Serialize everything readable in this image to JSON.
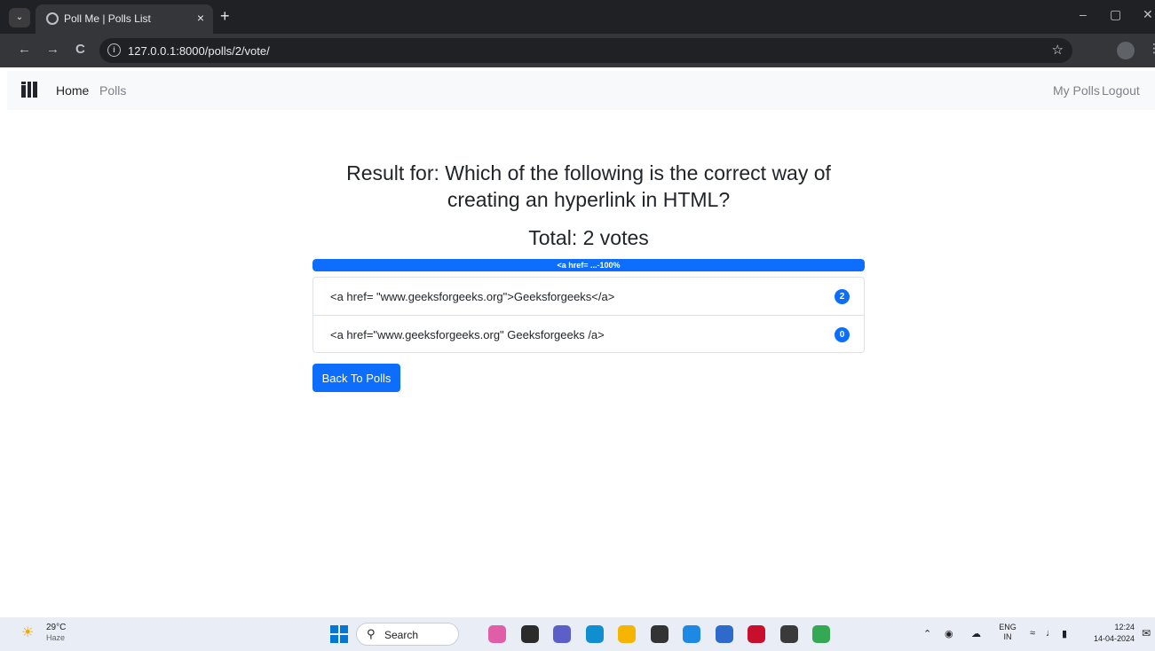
{
  "browser": {
    "tab_title": "Poll Me | Polls List",
    "url": "127.0.0.1:8000/polls/2/vote/",
    "new_tab": "+",
    "tab_close": "×",
    "minimize": "–",
    "restore": "▢",
    "close": "✕",
    "back": "←",
    "forward": "→",
    "reload": "C",
    "info": "i",
    "star": "☆",
    "kebab": "⋮",
    "tab_menu": "⌄"
  },
  "navbar": {
    "links": [
      "Home",
      "Polls"
    ],
    "right_links": [
      "My Polls",
      "Logout"
    ]
  },
  "result": {
    "title_line1": "Result for: Which of the following is the correct way of",
    "title_line2": "creating an hyperlink in HTML?",
    "total": "Total: 2 votes",
    "progress_label": "<a href= ...-100%",
    "progress_percent": 100,
    "choices": [
      {
        "text": "<a href= \"www.geeksforgeeks.org\">Geeksforgeeks</a>",
        "votes": "2"
      },
      {
        "text": "<a href=\"www.geeksforgeeks.org\" Geeksforgeeks /a>",
        "votes": "0"
      }
    ],
    "back_button": "Back To Polls"
  },
  "taskbar": {
    "temperature": "29°C",
    "condition": "Haze",
    "search_label": "Search",
    "lang_line1": "ENG",
    "lang_line2": "IN",
    "time": "12:24",
    "date": "14-04-2024",
    "apps": [
      {
        "name": "copilot",
        "color": "#e05ea8"
      },
      {
        "name": "task-view",
        "color": "#2b2b2b"
      },
      {
        "name": "meet",
        "color": "#5b5fc7"
      },
      {
        "name": "edge",
        "color": "#0f8fcf"
      },
      {
        "name": "file-explorer",
        "color": "#f4b400"
      },
      {
        "name": "github",
        "color": "#333333"
      },
      {
        "name": "vscode",
        "color": "#1e88e5"
      },
      {
        "name": "store",
        "color": "#2d6ac9"
      },
      {
        "name": "mcafee",
        "color": "#c8102e"
      },
      {
        "name": "terminal",
        "color": "#3a3a3a"
      },
      {
        "name": "chrome",
        "color": "#34a853"
      }
    ]
  },
  "colors": {
    "primary": "#0d6efd",
    "navbar_bg": "#f8f9fa",
    "browser_dark": "#202124"
  }
}
